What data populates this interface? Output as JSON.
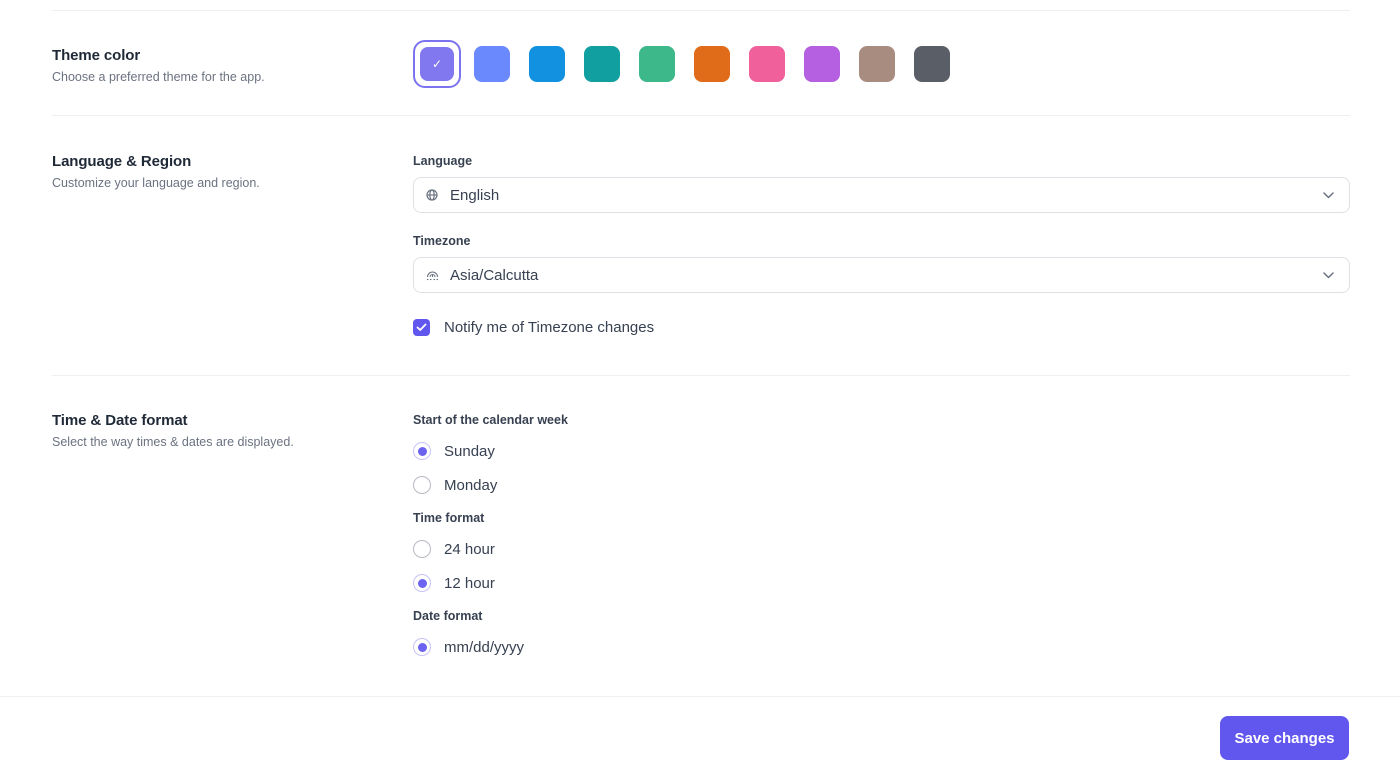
{
  "theme": {
    "title": "Theme color",
    "description": "Choose a preferred theme for the app.",
    "selected_index": 0,
    "swatches": [
      {
        "name": "indigo",
        "color": "#8178f0"
      },
      {
        "name": "blue",
        "color": "#6a89fc"
      },
      {
        "name": "sky",
        "color": "#1191e0"
      },
      {
        "name": "teal",
        "color": "#129fa0"
      },
      {
        "name": "green",
        "color": "#3db88a"
      },
      {
        "name": "orange",
        "color": "#e06c1a"
      },
      {
        "name": "pink",
        "color": "#f0609a"
      },
      {
        "name": "purple",
        "color": "#b460e0"
      },
      {
        "name": "taupe",
        "color": "#a98c80"
      },
      {
        "name": "slate",
        "color": "#5a5e66"
      }
    ],
    "check_glyph": "✓"
  },
  "language_region": {
    "title": "Language & Region",
    "description": "Customize your language and region.",
    "language": {
      "label": "Language",
      "value": "English",
      "icon": "globe-icon"
    },
    "timezone": {
      "label": "Timezone",
      "value": "Asia/Calcutta",
      "icon": "timezone-icon"
    },
    "notify": {
      "label": "Notify me of Timezone changes",
      "checked": true
    }
  },
  "time_date": {
    "title": "Time & Date format",
    "description": "Select the way times & dates are displayed.",
    "week_start": {
      "label": "Start of the calendar week",
      "options": [
        {
          "label": "Sunday",
          "checked": true
        },
        {
          "label": "Monday",
          "checked": false
        }
      ]
    },
    "time_format": {
      "label": "Time format",
      "options": [
        {
          "label": "24 hour",
          "checked": false
        },
        {
          "label": "12 hour",
          "checked": true
        }
      ]
    },
    "date_format": {
      "label": "Date format",
      "options": [
        {
          "label": "mm/dd/yyyy",
          "checked": true
        }
      ]
    }
  },
  "footer": {
    "save_label": "Save changes",
    "accent": "#6157ee"
  }
}
